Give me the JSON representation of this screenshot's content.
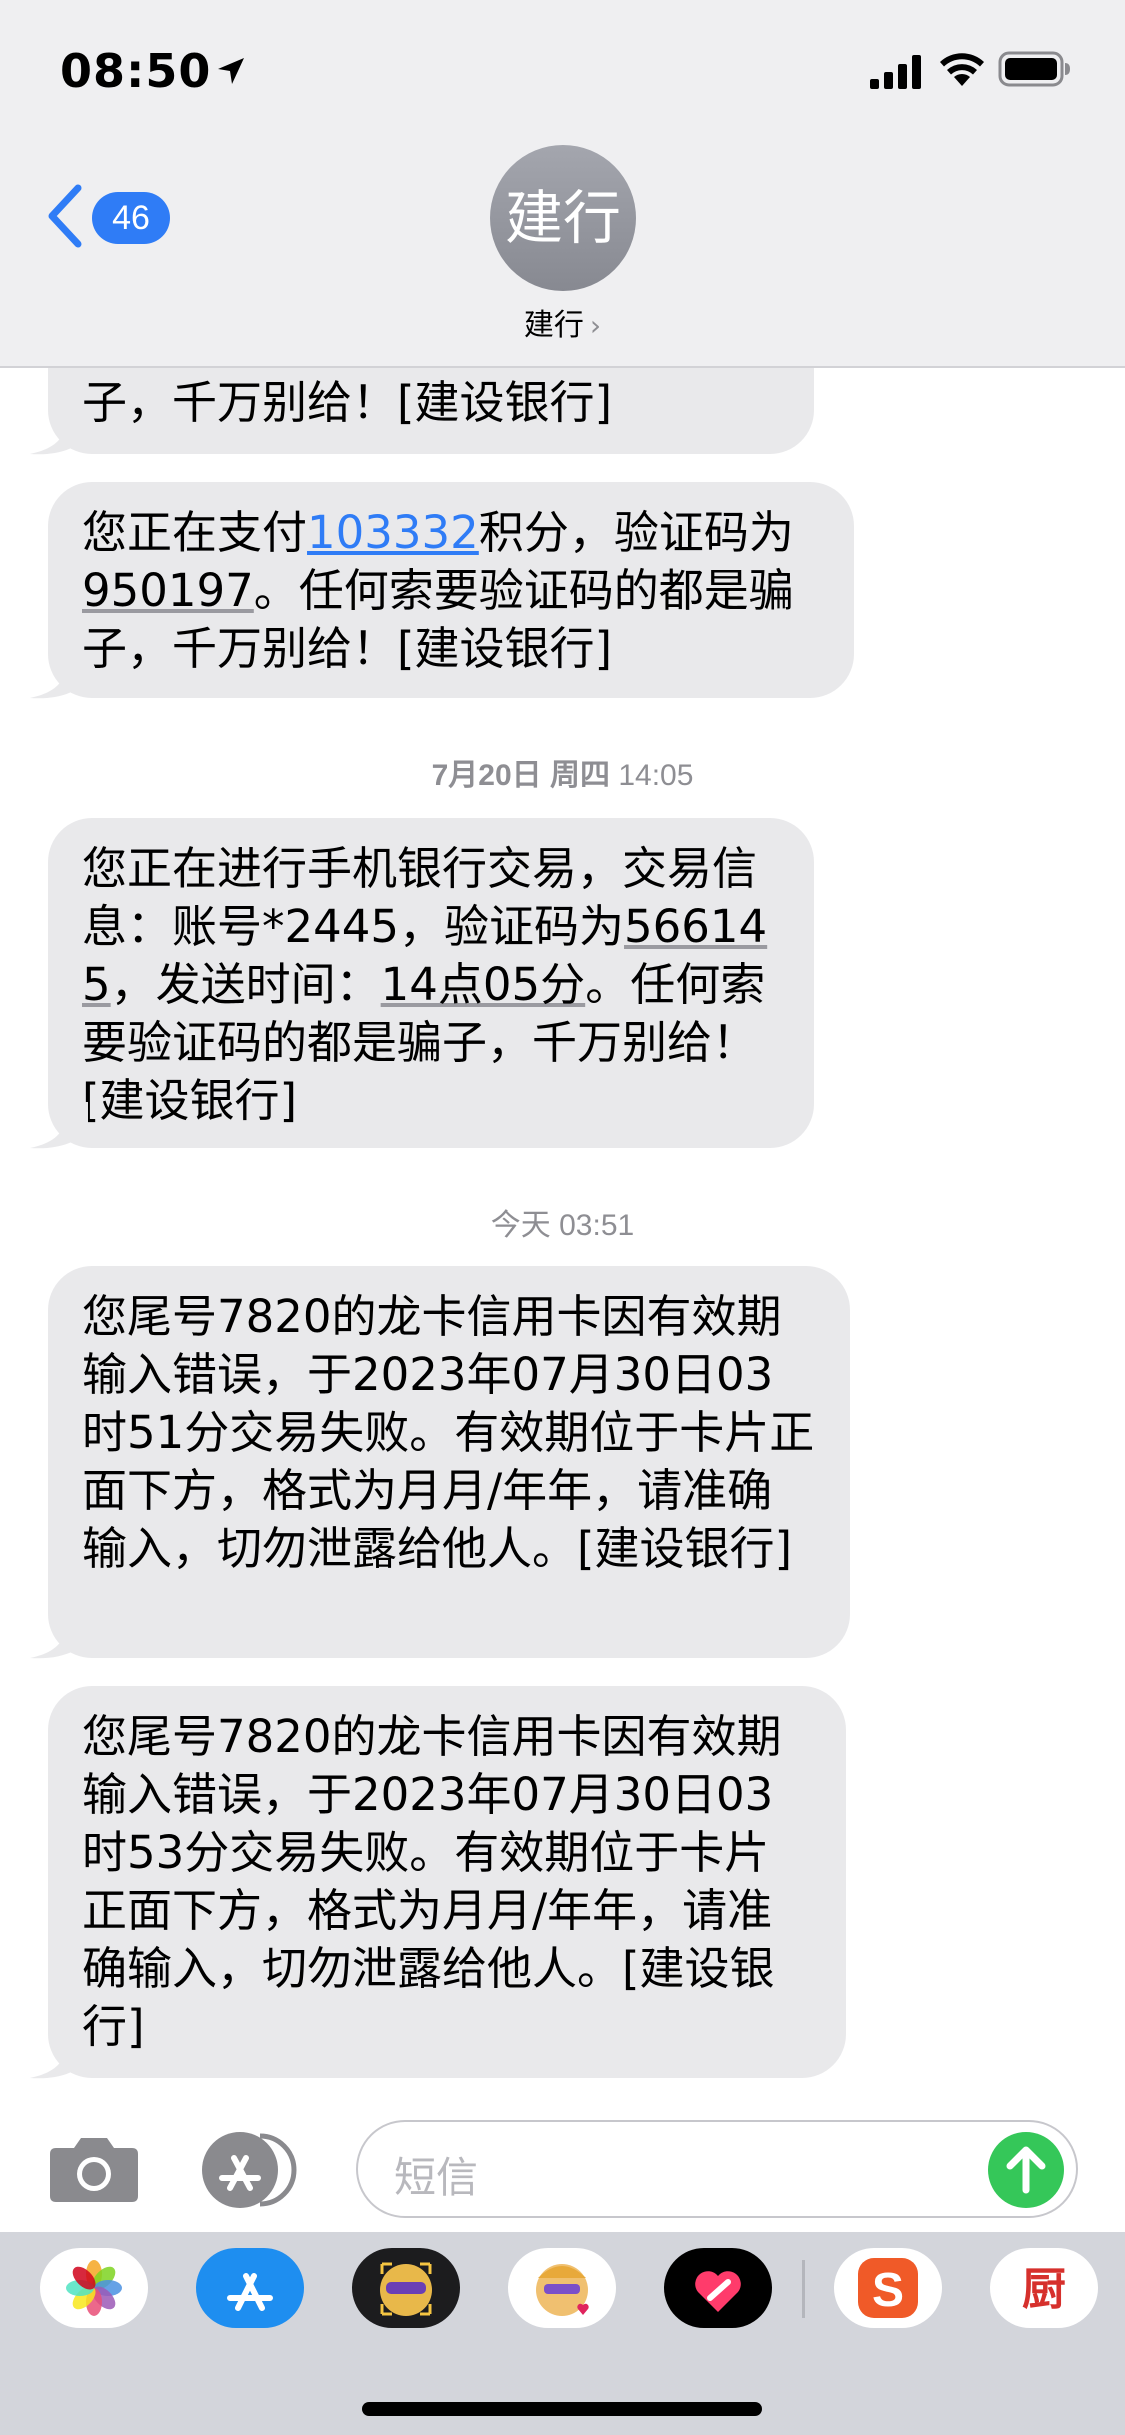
{
  "status_bar": {
    "time": "08:50"
  },
  "header": {
    "unread_count": "46",
    "avatar_text": "建行",
    "contact_name": "建行",
    "contact_chevron": "›"
  },
  "messages": [
    {
      "type": "bubble",
      "partial": true,
      "segments": [
        {
          "text": "子，千万别给！[建设银行]"
        }
      ]
    },
    {
      "type": "bubble",
      "segments": [
        {
          "text": "您正在支付"
        },
        {
          "text": "103332",
          "style": "link"
        },
        {
          "text": "积分，验证码为"
        },
        {
          "text": "950197",
          "style": "underline"
        },
        {
          "text": "。任何索要验证码的都是骗子，千万别给！[建设银行]"
        }
      ]
    },
    {
      "type": "timestamp",
      "date": "7月20日 周四",
      "time": "14:05"
    },
    {
      "type": "bubble",
      "segments": [
        {
          "text": "您正在进行手机银行交易，交易信息：账号*2445，验证码为"
        },
        {
          "text": "566145",
          "style": "underline"
        },
        {
          "text": "，发送时间："
        },
        {
          "text": "14点05分",
          "style": "underline"
        },
        {
          "text": "。任何索要验证码的都是骗子，千万别给！[建设银行]"
        }
      ]
    },
    {
      "type": "timestamp",
      "date": "今天",
      "time": "03:51"
    },
    {
      "type": "bubble",
      "segments": [
        {
          "text": "您尾号7820的龙卡信用卡因有效期输入错误，于2023年07月30日03时51分交易失败。有效期位于卡片正面下方，格式为月月/年年，请准确输入，切勿泄露给他人。[建设银行]"
        }
      ]
    },
    {
      "type": "bubble",
      "segments": [
        {
          "text": "您尾号7820的龙卡信用卡因有效期输入错误，于2023年07月30日03时53分交易失败。有效期位于卡片正面下方，格式为月月/年年，请准确输入，切勿泄露给他人。[建设银行]"
        }
      ]
    }
  ],
  "input": {
    "placeholder": "短信"
  },
  "app_drawer": {
    "apps": [
      {
        "name": "photos-app-icon"
      },
      {
        "name": "app-store-app-icon"
      },
      {
        "name": "memoji-stickers-app-icon"
      },
      {
        "name": "memoji-app-icon"
      },
      {
        "name": "digital-touch-app-icon"
      },
      {
        "name": "sogou-keyboard-app-icon",
        "glyph": "S"
      },
      {
        "name": "xiachufang-app-icon",
        "glyph": "厨"
      }
    ]
  },
  "colors": {
    "header_bg": "#efeff1",
    "bubble_bg": "#e9e9eb",
    "accent_blue": "#2f7cf6",
    "send_green": "#35c759",
    "timestamp_gray": "#8e8e93"
  }
}
